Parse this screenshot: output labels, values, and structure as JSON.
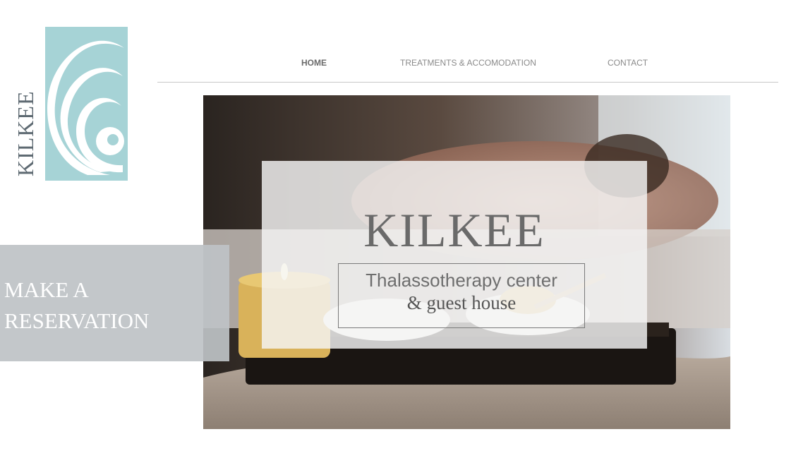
{
  "brand": {
    "logo_text": "KILKEE",
    "colors": {
      "logo_teal": "#a6d3d6",
      "logo_text": "#5e6a72",
      "nav_text": "#8a8a8a",
      "cta_bg": "#bec2c5"
    }
  },
  "nav": {
    "items": [
      {
        "label": "HOME",
        "active": true
      },
      {
        "label": "TREATMENTS & ACCOMODATION",
        "active": false
      },
      {
        "label": "CONTACT",
        "active": false
      }
    ]
  },
  "hero": {
    "title": "KILKEE",
    "tagline_line1": "Thalassotherapy center",
    "tagline_line2": "& guest house",
    "image": "spa-massage-photo"
  },
  "cta": {
    "line1": "MAKE A",
    "line2": "RESERVATION"
  }
}
